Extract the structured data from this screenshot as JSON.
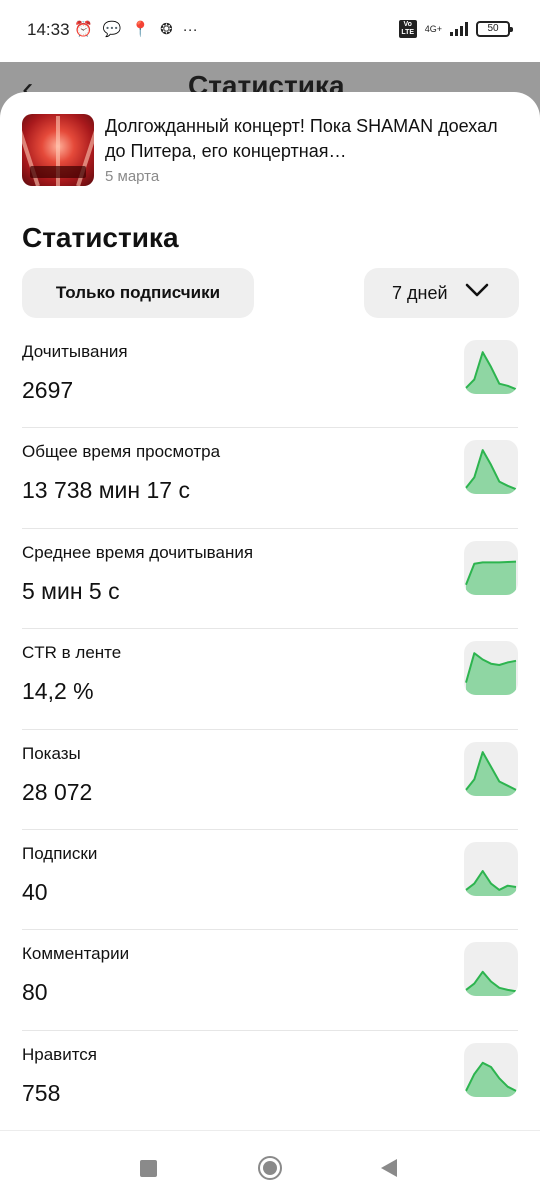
{
  "status_bar": {
    "time": "14:33",
    "icons_left": [
      "alarm-icon",
      "chat-icon",
      "location-icon",
      "assistant-icon",
      "more-icon"
    ],
    "network_label": "4G+",
    "volte_label": "Vo LTE",
    "battery": "50"
  },
  "background_header": {
    "back_icon": "chevron-left-icon",
    "title": "Статистика"
  },
  "post": {
    "title": "Долгожданный концерт! Пока SHAMAN доехал до Питера, его концертная…",
    "date": "5 марта"
  },
  "stats": {
    "title": "Статистика",
    "filter_label": "Только подписчики",
    "period_label": "7 дней"
  },
  "colors": {
    "spark_stroke": "#2db44f",
    "spark_fill": "#8fd6a3",
    "chip_bg": "#efefef"
  },
  "metrics": [
    {
      "label": "Дочитывания",
      "value": "2697",
      "trend": [
        0.05,
        0.25,
        0.9,
        0.55,
        0.15,
        0.1,
        0.02
      ]
    },
    {
      "label": "Общее время просмотра",
      "value": "13 738 мин 17 с",
      "trend": [
        0.05,
        0.3,
        0.95,
        0.6,
        0.2,
        0.1,
        0.02
      ]
    },
    {
      "label": "Среднее время дочитывания",
      "value": "5 мин 5 с",
      "trend": [
        0.15,
        0.65,
        0.68,
        0.68,
        0.68,
        0.69,
        0.7
      ]
    },
    {
      "label": "CTR в ленте",
      "value": "14,2 %",
      "trend": [
        0.2,
        0.9,
        0.75,
        0.65,
        0.62,
        0.68,
        0.72
      ]
    },
    {
      "label": "Показы",
      "value": "28 072",
      "trend": [
        0.05,
        0.3,
        0.95,
        0.6,
        0.25,
        0.15,
        0.05
      ]
    },
    {
      "label": "Подписки",
      "value": "40",
      "trend": [
        0.05,
        0.2,
        0.5,
        0.2,
        0.05,
        0.15,
        0.12
      ]
    },
    {
      "label": "Комментарии",
      "value": "80",
      "trend": [
        0.05,
        0.2,
        0.48,
        0.25,
        0.1,
        0.05,
        0.02
      ]
    },
    {
      "label": "Нравится",
      "value": "758",
      "trend": [
        0.05,
        0.45,
        0.72,
        0.62,
        0.35,
        0.15,
        0.05
      ]
    }
  ],
  "nav_bar": {
    "buttons": [
      "recents-icon",
      "home-icon",
      "back-icon"
    ]
  }
}
